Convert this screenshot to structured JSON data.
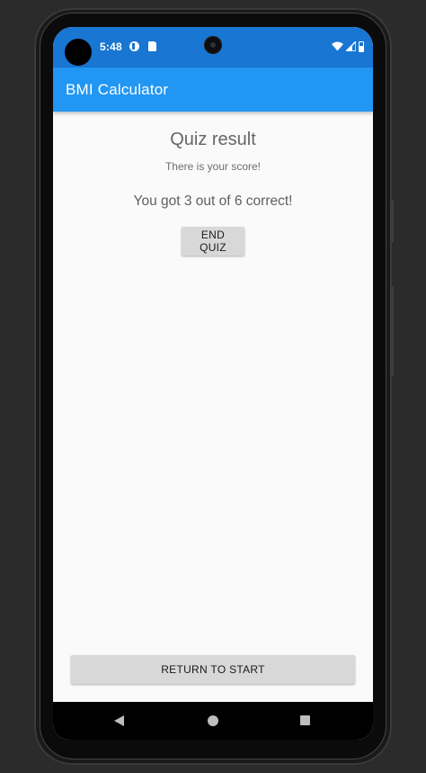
{
  "status_bar": {
    "time": "5:48",
    "icons": [
      "punch-hole",
      "play-protect-icon",
      "sd-card-icon",
      "wifi-icon",
      "signal-icon",
      "battery-icon"
    ]
  },
  "app_bar": {
    "title": "BMI Calculator",
    "color": "#2196f3"
  },
  "main": {
    "title": "Quiz result",
    "subtitle": "There is your score!",
    "score_text": "You got 3 out of 6 correct!",
    "end_quiz_label": "END QUIZ",
    "return_label": "RETURN TO START"
  },
  "nav_bar": {
    "icons": [
      "back-icon",
      "home-icon",
      "recents-icon"
    ]
  },
  "colors": {
    "status_bar": "#1976d2",
    "app_bar": "#2196f3",
    "background": "#fafafa",
    "button": "#d8d8d8"
  }
}
